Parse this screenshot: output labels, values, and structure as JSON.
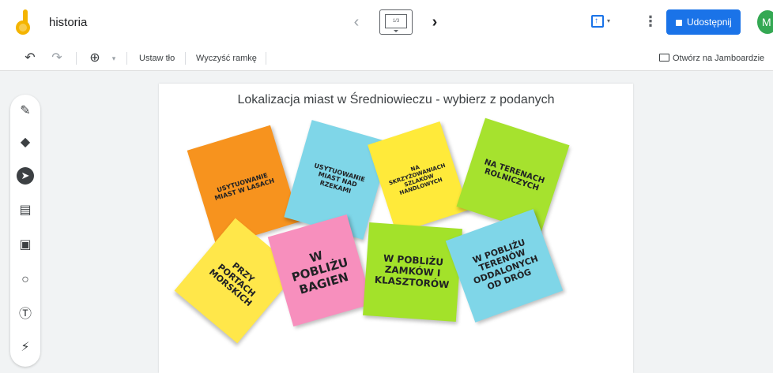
{
  "app": {
    "title": "historia",
    "frame_indicator": "1/3"
  },
  "topbar": {
    "prev_icon": "‹",
    "next_icon": "›",
    "share_label": "Udostępnij",
    "avatar_letter": "M"
  },
  "toolbar": {
    "undo_icon": "↶",
    "redo_icon": "↷",
    "zoom_icon": "⊕",
    "zoom_dd": "▾",
    "set_bg": "Ustaw tło",
    "clear_frame": "Wyczyść ramkę",
    "open_jamboard": "Otwórz na Jamboardzie"
  },
  "tools": [
    {
      "name": "pen-tool-icon",
      "glyph": "✎"
    },
    {
      "name": "eraser-tool-icon",
      "glyph": "◆"
    },
    {
      "name": "select-tool-icon",
      "glyph": "➤"
    },
    {
      "name": "sticky-note-tool-icon",
      "glyph": "▤"
    },
    {
      "name": "image-tool-icon",
      "glyph": "▣"
    },
    {
      "name": "shape-tool-icon",
      "glyph": "○"
    },
    {
      "name": "text-box-tool-icon",
      "glyph": "Ⓣ"
    },
    {
      "name": "laser-tool-icon",
      "glyph": "⚡"
    }
  ],
  "canvas": {
    "title": "Lokalizacja miast w Średniowieczu - wybierz z podanych"
  },
  "notes": [
    {
      "text": "Usytuowanie miast w lasach",
      "color": "#f7931e"
    },
    {
      "text": "Usytuowanie miast nad rzekami",
      "color": "#7fd6e8"
    },
    {
      "text": "Na skrzyżowaniach szlaków handlowych",
      "color": "#ffea3a"
    },
    {
      "text": "Na terenach rolniczych",
      "color": "#a6e22e"
    },
    {
      "text": "Przy portach morskich",
      "color": "#ffe74a"
    },
    {
      "text": "W pobliżu bagien",
      "color": "#f78fbd"
    },
    {
      "text": "W pobliżu zamków i klasztorów",
      "color": "#a3e22a"
    },
    {
      "text": "W pobliżu terenów oddalonych od dróg",
      "color": "#7fd6e8"
    }
  ]
}
